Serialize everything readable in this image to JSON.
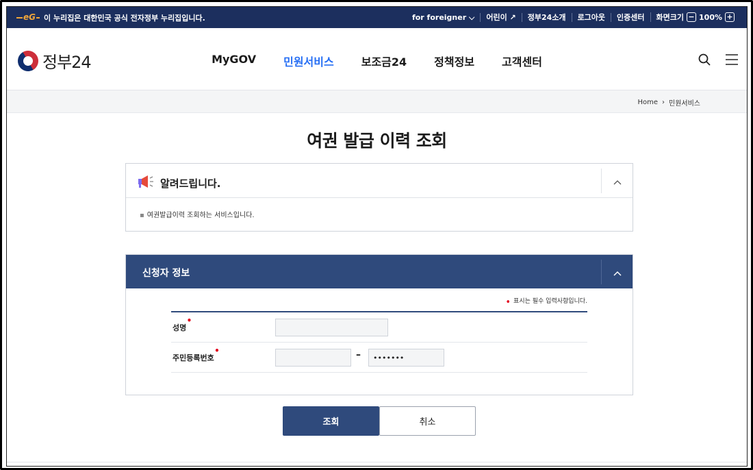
{
  "topbar": {
    "notice": "이 누리집은 대한민국 공식 전자정부 누리집입니다.",
    "eg_logo": "eG",
    "foreigner": "for foreigner",
    "kids": "어린이",
    "about": "정부24소개",
    "logout": "로그아웃",
    "cert_center": "인증센터",
    "zoom_label": "화면크기",
    "zoom_minus": "−",
    "zoom_value": "100%",
    "zoom_plus": "+"
  },
  "header": {
    "logo_text": "정부24",
    "nav": [
      {
        "label": "MyGOV"
      },
      {
        "label": "민원서비스"
      },
      {
        "label": "보조금24"
      },
      {
        "label": "정책정보"
      },
      {
        "label": "고객센터"
      }
    ],
    "active_nav_color": "#256ef4"
  },
  "breadcrumb": {
    "home": "Home",
    "separator": "›",
    "current": "민원서비스"
  },
  "page": {
    "title": "여권 발급 이력 조회"
  },
  "notice": {
    "title": "알려드립니다.",
    "body": "여권발급이력 조회하는 서비스입니다."
  },
  "applicant": {
    "title": "신청자 정보",
    "required_note": "표시는 필수 입력사항입니다.",
    "required_mark": "•",
    "fields": {
      "name_label": "성명",
      "name_value": "",
      "rrn_label": "주민등록번호",
      "rrn_front_value": "",
      "rrn_dash": "–",
      "rrn_back_value": "•••••••"
    }
  },
  "buttons": {
    "submit": "조회",
    "cancel": "취소"
  },
  "colors": {
    "topbar": "#1c2f5e",
    "section_header": "#2f4a7c",
    "required": "#e3001b"
  }
}
